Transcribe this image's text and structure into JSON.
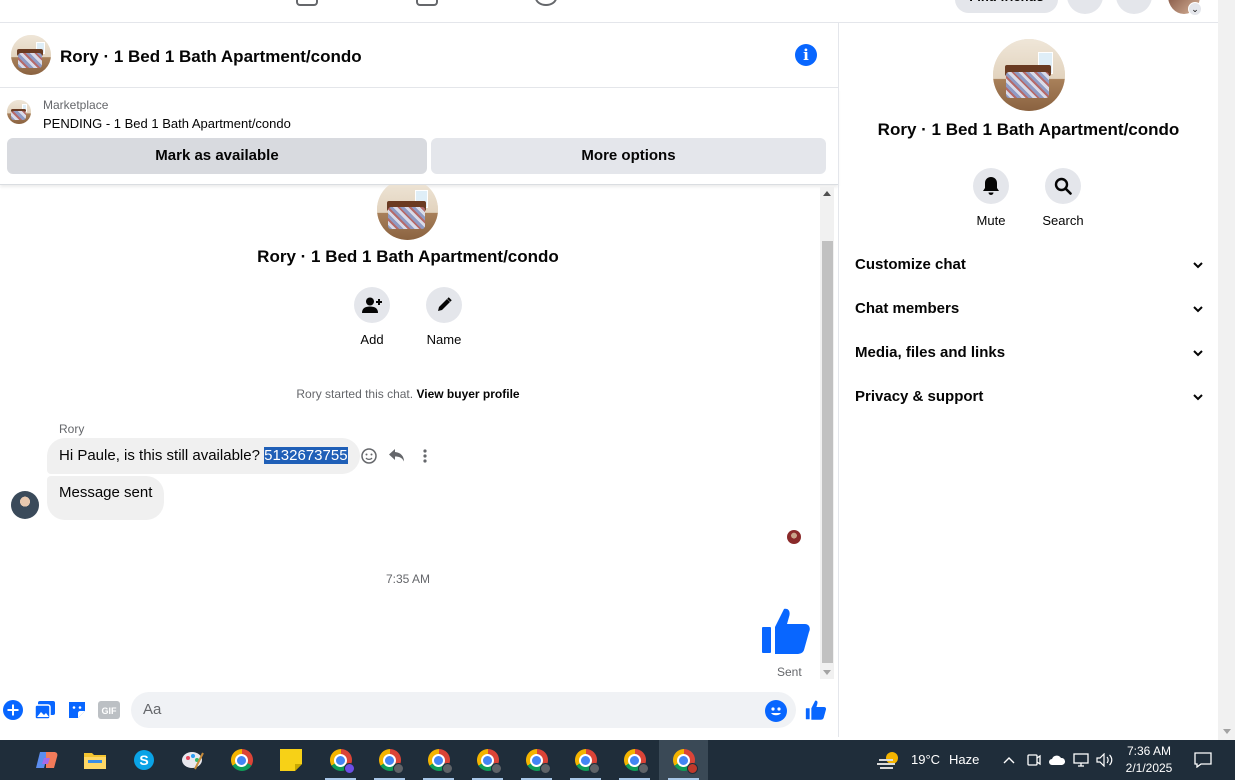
{
  "topbar": {
    "find_friends": "Find friends"
  },
  "chat": {
    "title": "Rory · 1 Bed 1 Bath Apartment/condo",
    "marketplace_label": "Marketplace",
    "listing_status": "PENDING - 1 Bed 1 Bath Apartment/condo",
    "btn_mark_available": "Mark as available",
    "btn_more_options": "More options"
  },
  "thread": {
    "hero_title": "Rory · 1 Bed 1 Bath Apartment/condo",
    "actions": [
      {
        "label": "Add",
        "icon": "add-person-icon"
      },
      {
        "label": "Name",
        "icon": "pencil-icon"
      }
    ],
    "started_text": "Rory started this chat.",
    "view_buyer_profile": "View buyer profile",
    "sender_name": "Rory",
    "message1_text": "Hi Paule, is this still available?",
    "message1_selected": "5132673755",
    "message2_text": "Message sent",
    "timestamp": "7:35 AM",
    "sent_status": "Sent"
  },
  "composer": {
    "placeholder": "Aa",
    "gif_label": "GIF"
  },
  "panel": {
    "title": "Rory · 1 Bed 1 Bath Apartment/condo",
    "mute_label": "Mute",
    "search_label": "Search",
    "sections": [
      "Customize chat",
      "Chat members",
      "Media, files and links",
      "Privacy & support"
    ]
  },
  "taskbar": {
    "weather_temp": "19°C",
    "weather_cond": "Haze",
    "time": "7:36 AM",
    "date": "2/1/2025"
  },
  "colors": {
    "accent": "#0866ff",
    "selection": "#1f5fb7",
    "taskbar": "#1f2d3a"
  }
}
